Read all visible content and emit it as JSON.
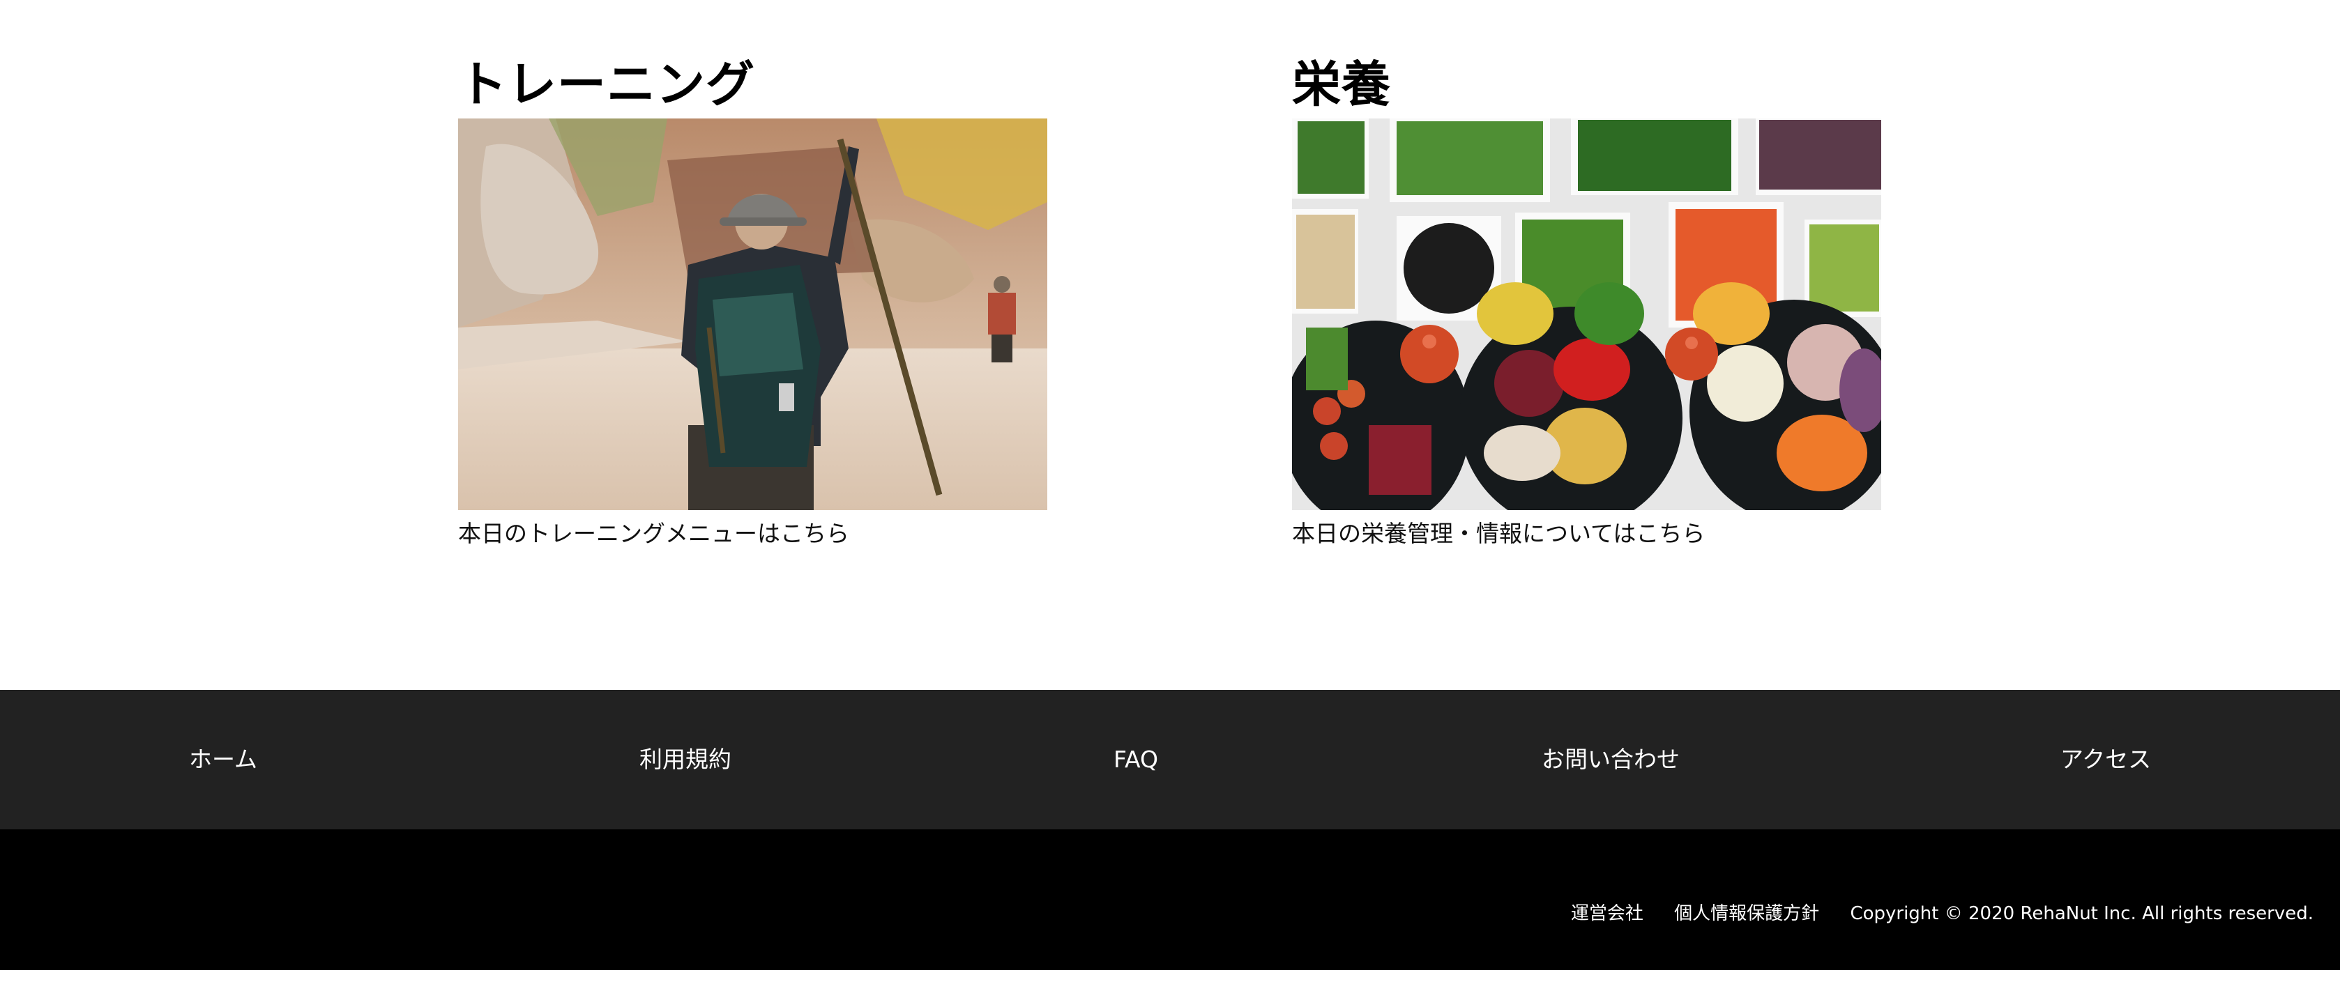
{
  "cards": [
    {
      "title": "トレーニング",
      "caption": "本日のトレーニングメニューはこちら",
      "image": "hiker-in-canyon-river-photo"
    },
    {
      "title": "栄養",
      "caption": "本日の栄養管理・情報についてはこちら",
      "image": "vegetable-platter-photo"
    }
  ],
  "footer_nav": {
    "items": [
      "ホーム",
      "利用規約",
      "FAQ",
      "お問い合わせ",
      "アクセス"
    ]
  },
  "footer_bottom": {
    "company_link": "運営会社",
    "privacy_link": "個人情報保護方針",
    "copyright": "Copyright © 2020 RehaNut Inc. All rights reserved."
  },
  "colors": {
    "footer_nav_bg": "#222222",
    "footer_bottom_bg": "#000000",
    "footer_text": "#ffffff"
  }
}
